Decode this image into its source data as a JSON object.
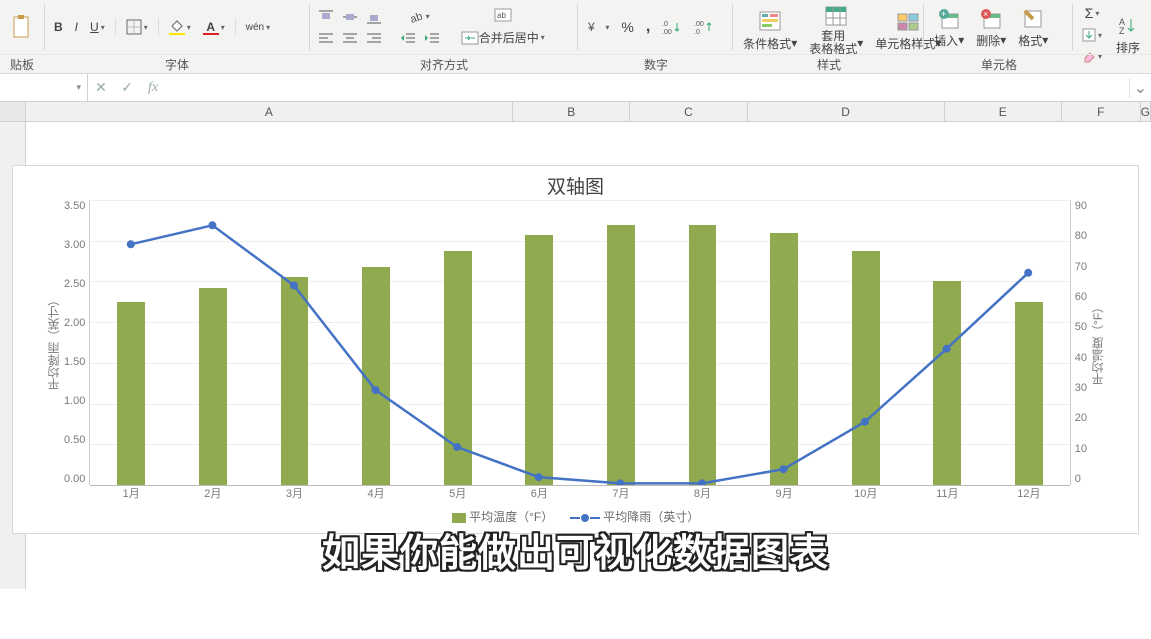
{
  "ribbon": {
    "clipboard": {
      "label": "粘贴",
      "paste": "粘贴",
      "group_stub": "贴板"
    },
    "font": {
      "label": "字体",
      "bold": "B",
      "italic": "I",
      "underline": "U",
      "wen": "wén"
    },
    "alignment": {
      "label": "对齐方式",
      "merge": "合并后居中"
    },
    "number": {
      "label": "数字",
      "inc_dec_left": ".00→.0",
      "inc_dec_right": ".0→.00"
    },
    "styles": {
      "label": "样式",
      "cond": "条件格式",
      "table": "套用\n表格格式",
      "cell": "单元格样式"
    },
    "cells": {
      "label": "单元格",
      "insert": "插入",
      "delete": "删除",
      "format": "格式"
    },
    "editing": {
      "sort": "排序"
    }
  },
  "formula_bar": {
    "name": "",
    "cancel": "✕",
    "enter": "✓",
    "fx": "fx"
  },
  "columns": [
    "A",
    "B",
    "C",
    "D",
    "E",
    "F",
    "G"
  ],
  "chart_data": {
    "type": "bar+line",
    "title": "双轴图",
    "categories": [
      "1月",
      "2月",
      "3月",
      "4月",
      "5月",
      "6月",
      "7月",
      "8月",
      "9月",
      "10月",
      "11月",
      "12月"
    ],
    "series": [
      {
        "name": "平均温度（°F）",
        "kind": "bar",
        "axis": "left",
        "values": [
          2.25,
          2.42,
          2.56,
          2.68,
          2.88,
          3.07,
          3.19,
          3.19,
          3.1,
          2.88,
          2.5,
          2.25
        ]
      },
      {
        "name": "平均降雨（英寸）",
        "kind": "line",
        "axis": "right",
        "values": [
          76,
          82,
          63,
          30,
          12,
          2.5,
          0.5,
          0.5,
          5,
          20,
          43,
          67
        ]
      }
    ],
    "ylabel_left": "平均降雨（英寸）",
    "ylabel_right": "平均温度（°F）",
    "ylim_left": [
      0.0,
      3.5
    ],
    "yticks_left": [
      "3.50",
      "3.00",
      "2.50",
      "2.00",
      "1.50",
      "1.00",
      "0.50",
      "0.00"
    ],
    "ylim_right": [
      0,
      90
    ],
    "yticks_right": [
      "90",
      "80",
      "70",
      "60",
      "50",
      "40",
      "30",
      "20",
      "10",
      "0"
    ]
  },
  "overlay_caption": "如果你能做出可视化数据图表"
}
